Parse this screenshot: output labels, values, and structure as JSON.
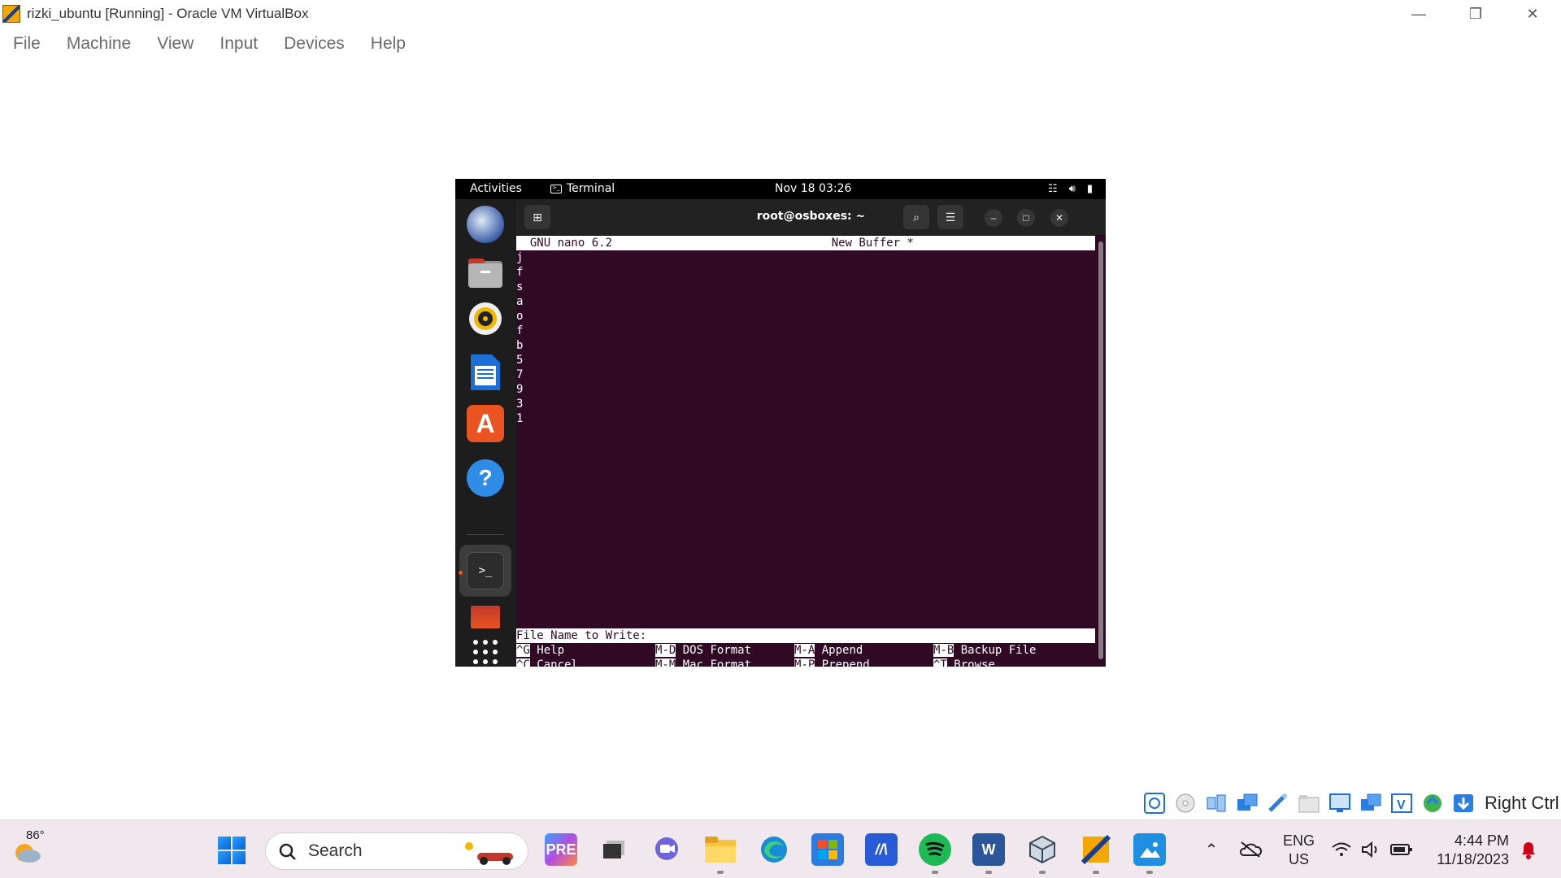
{
  "window": {
    "title": "rizki_ubuntu [Running] - Oracle VM VirtualBox",
    "minimize_icon": "—",
    "restore_icon": "❐",
    "close_icon": "✕"
  },
  "menubar": {
    "items": [
      "File",
      "Machine",
      "View",
      "Input",
      "Devices",
      "Help"
    ]
  },
  "gnome": {
    "activities": "Activities",
    "app_name": "Terminal",
    "clock": "Nov 18  03:26"
  },
  "terminal": {
    "title": "root@osboxes: ~",
    "nano_header": "  GNU nano 6.2                                New Buffer *",
    "lines": [
      "j",
      "f",
      "s",
      "a",
      "o",
      "f",
      "b",
      "5",
      "7",
      "9",
      "3",
      "1"
    ],
    "prompt": "File Name to Write: ",
    "shortcuts": [
      [
        {
          "key": "^G",
          "label": " Help"
        },
        {
          "key": "M-D",
          "label": " DOS Format"
        },
        {
          "key": "M-A",
          "label": " Append"
        },
        {
          "key": "M-B",
          "label": " Backup File"
        }
      ],
      [
        {
          "key": "^C",
          "label": " Cancel"
        },
        {
          "key": "M-M",
          "label": " Mac Format"
        },
        {
          "key": "M-P",
          "label": " Prepend"
        },
        {
          "key": "^T",
          "label": " Browse"
        }
      ]
    ]
  },
  "vbox_status": {
    "host_key_label": "Right Ctrl"
  },
  "taskbar": {
    "temperature": "86°",
    "search_placeholder": "Search",
    "lang_line1": "ENG",
    "lang_line2": "US",
    "time": "4:44 PM",
    "date": "11/18/2023"
  },
  "colors": {
    "terminal_bg": "#300a24",
    "ubuntu_orange": "#e95420",
    "taskbar_bg": "#f1e8ee"
  }
}
